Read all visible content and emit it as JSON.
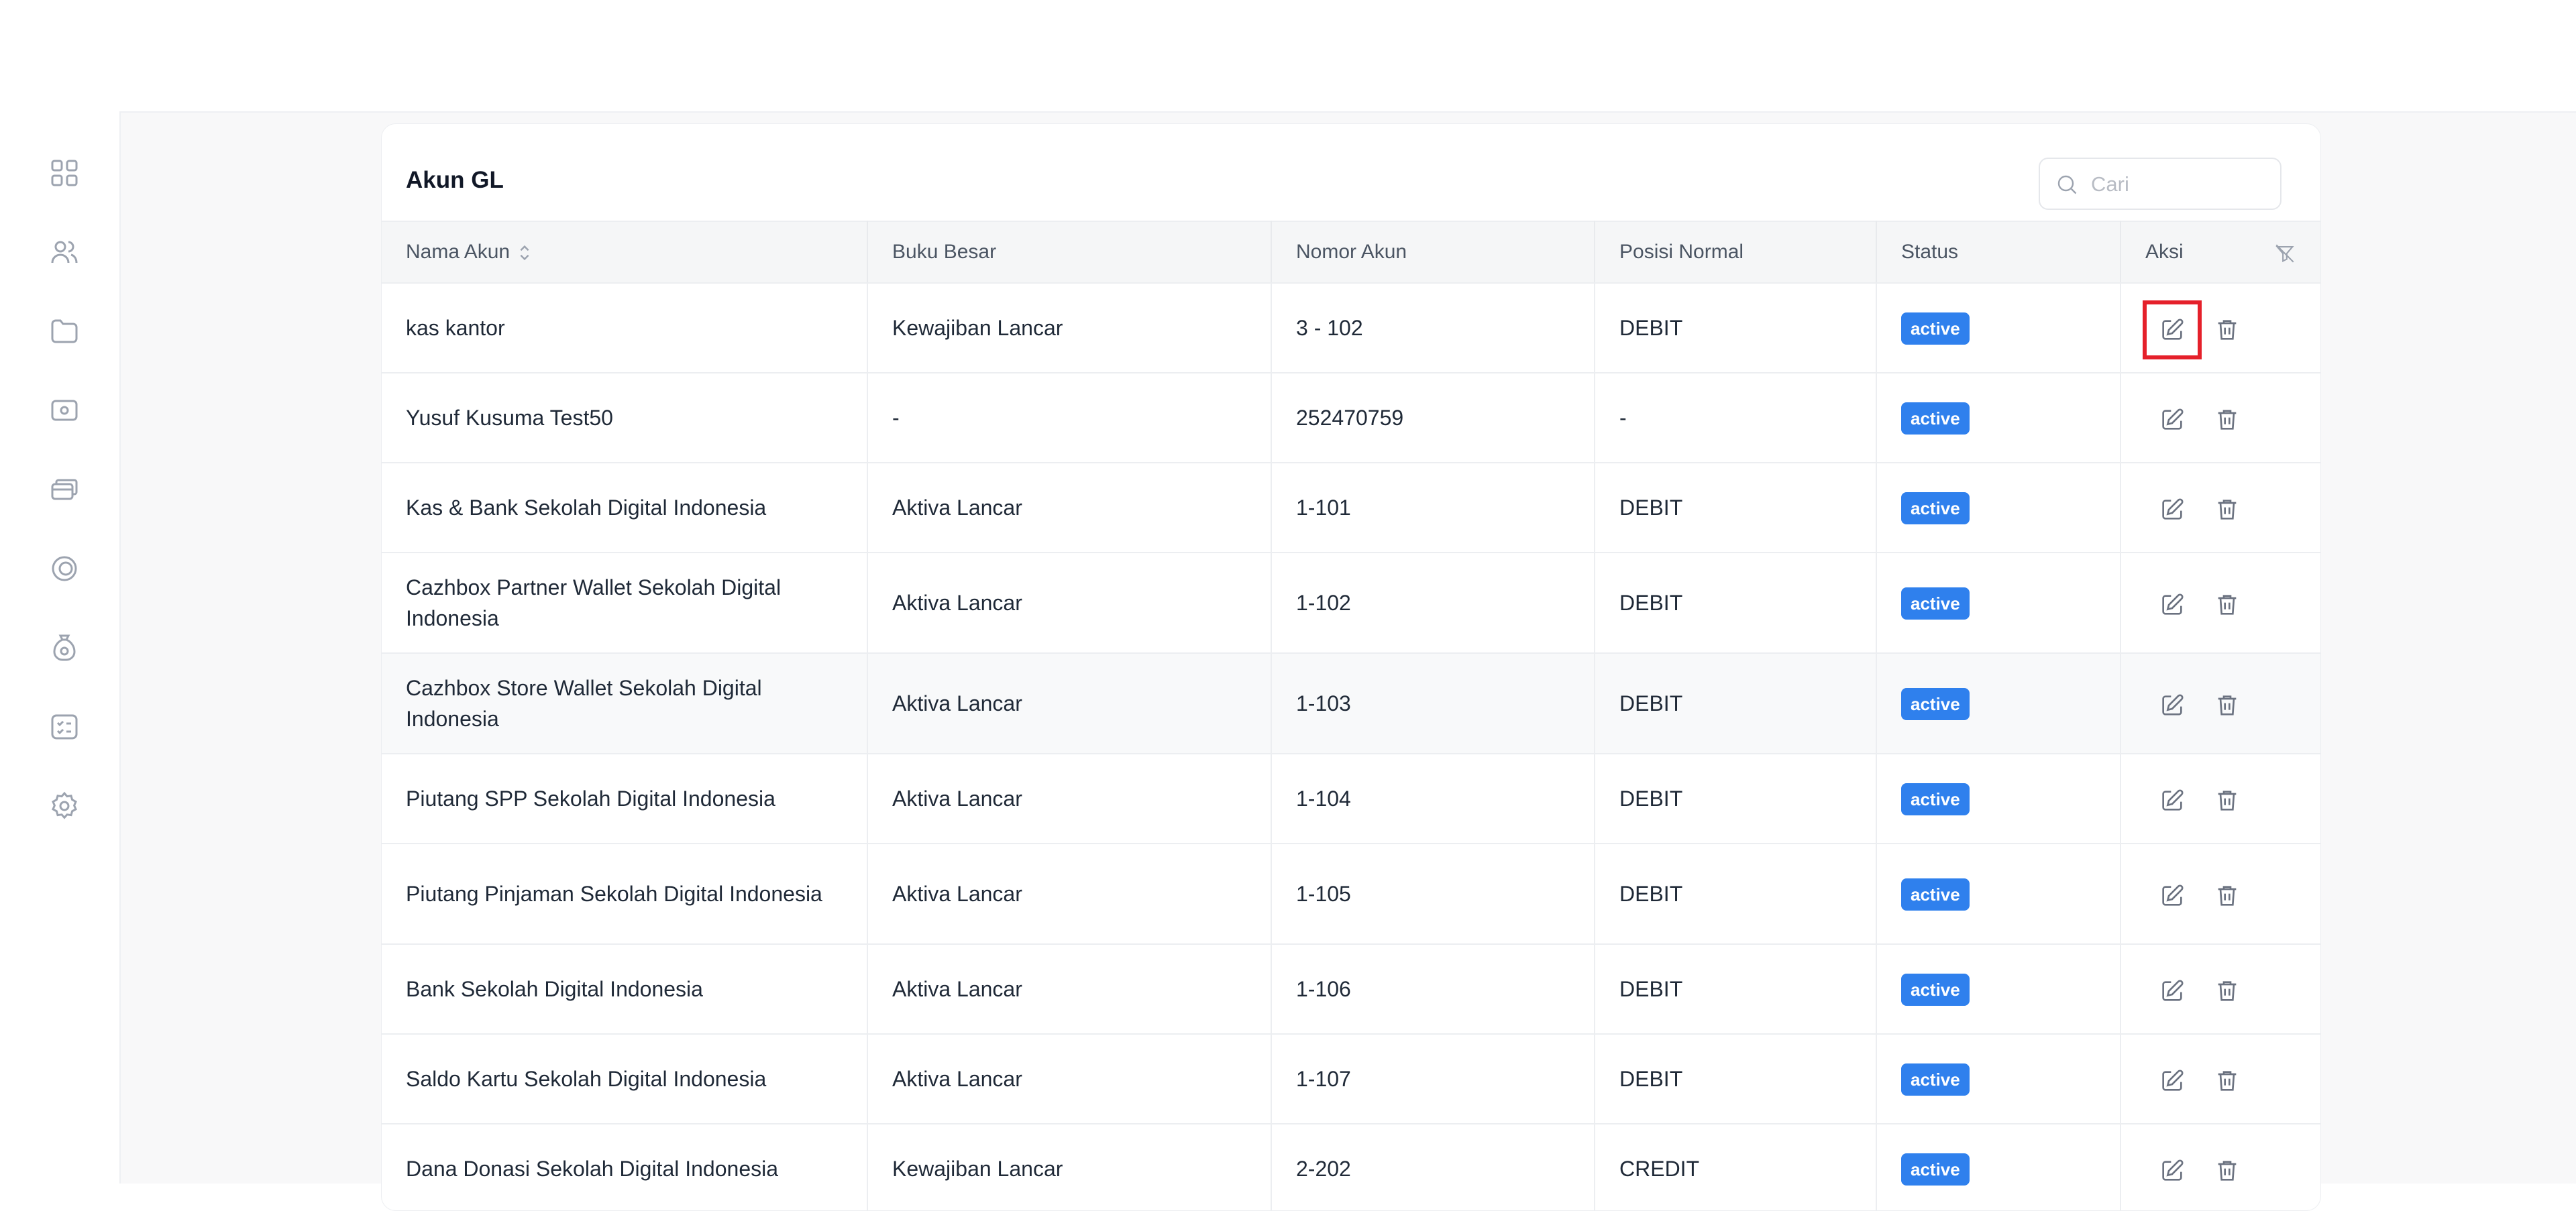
{
  "page": {
    "title": "Akun GL",
    "search_placeholder": "Cari"
  },
  "sidebar": {
    "icons": [
      "dashboard-grid-icon",
      "users-icon",
      "folder-icon",
      "wallet-icon",
      "cards-icon",
      "coin-icon",
      "money-bag-icon",
      "checklist-icon",
      "settings-icon"
    ]
  },
  "table": {
    "columns": [
      "Nama Akun",
      "Buku Besar",
      "Nomor Akun",
      "Posisi Normal",
      "Status",
      "Aksi"
    ],
    "rows": [
      {
        "name": "kas kantor",
        "ledger": "Kewajiban Lancar",
        "number": "3 - 102",
        "position": "DEBIT",
        "status": "active"
      },
      {
        "name": "Yusuf Kusuma Test50",
        "ledger": "-",
        "number": "252470759",
        "position": "-",
        "status": "active"
      },
      {
        "name": "Kas & Bank Sekolah Digital Indonesia",
        "ledger": "Aktiva Lancar",
        "number": "1-101",
        "position": "DEBIT",
        "status": "active"
      },
      {
        "name": "Cazhbox Partner Wallet Sekolah Digital Indonesia",
        "ledger": "Aktiva Lancar",
        "number": "1-102",
        "position": "DEBIT",
        "status": "active"
      },
      {
        "name": "Cazhbox Store Wallet Sekolah Digital Indonesia",
        "ledger": "Aktiva Lancar",
        "number": "1-103",
        "position": "DEBIT",
        "status": "active"
      },
      {
        "name": "Piutang SPP Sekolah Digital Indonesia",
        "ledger": "Aktiva Lancar",
        "number": "1-104",
        "position": "DEBIT",
        "status": "active"
      },
      {
        "name": "Piutang Pinjaman Sekolah Digital Indonesia",
        "ledger": "Aktiva Lancar",
        "number": "1-105",
        "position": "DEBIT",
        "status": "active"
      },
      {
        "name": "Bank Sekolah Digital Indonesia",
        "ledger": "Aktiva Lancar",
        "number": "1-106",
        "position": "DEBIT",
        "status": "active"
      },
      {
        "name": "Saldo Kartu Sekolah Digital Indonesia",
        "ledger": "Aktiva Lancar",
        "number": "1-107",
        "position": "DEBIT",
        "status": "active"
      },
      {
        "name": "Dana Donasi Sekolah Digital Indonesia",
        "ledger": "Kewajiban Lancar",
        "number": "2-202",
        "position": "CREDIT",
        "status": "active"
      }
    ]
  },
  "colors": {
    "badge": "#2f80ed",
    "highlight": "#e5202a"
  }
}
